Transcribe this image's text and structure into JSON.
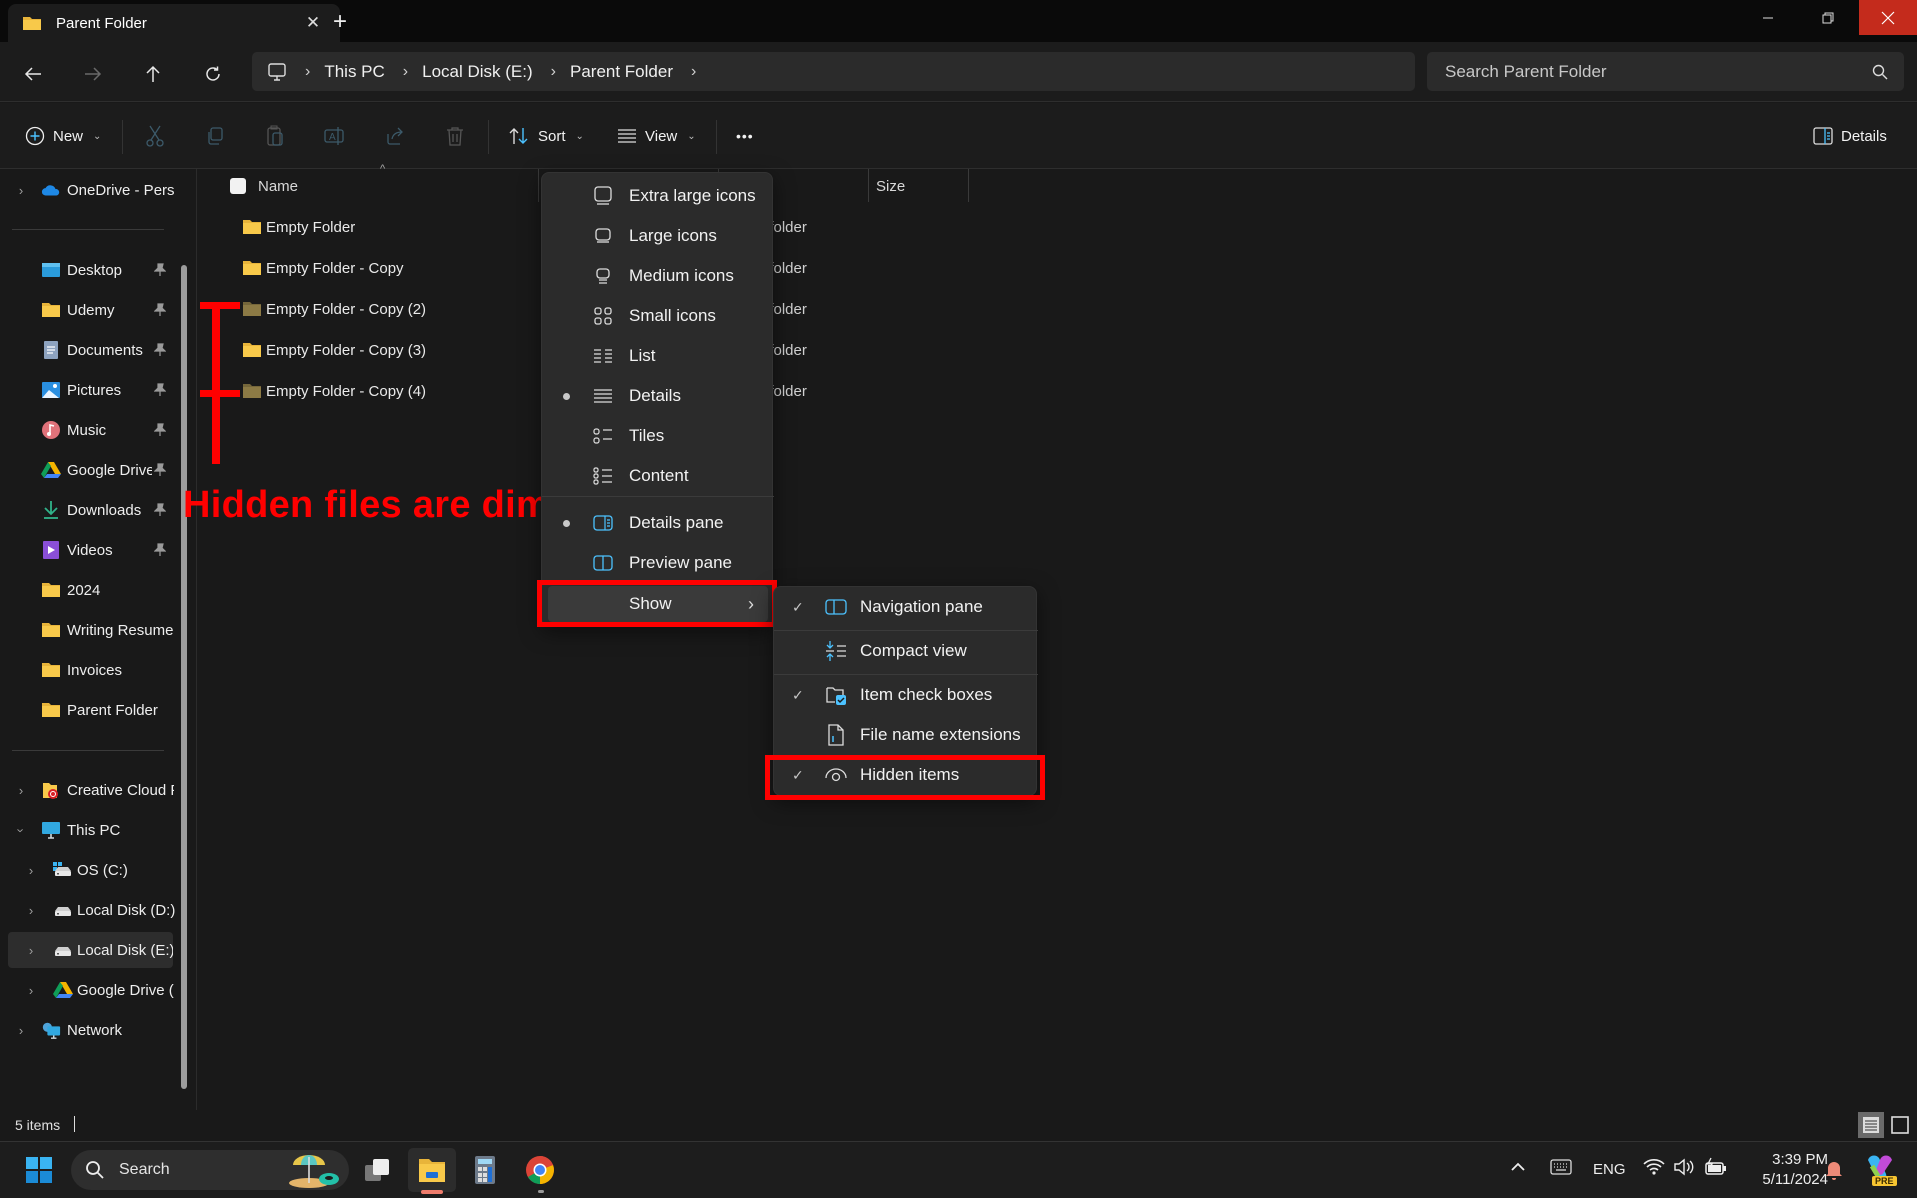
{
  "window": {
    "tab_title": "Parent Folder",
    "close_tab": "✕",
    "new_tab": "+",
    "min": "—",
    "max": "❐",
    "close": "✕"
  },
  "address": {
    "breadcrumbs": [
      "This PC",
      "Local Disk (E:)",
      "Parent Folder"
    ],
    "separator": "›"
  },
  "search": {
    "placeholder": "Search Parent Folder"
  },
  "toolbar": {
    "new_label": "New",
    "sort_label": "Sort",
    "view_label": "View",
    "more_label": "•••",
    "details_label": "Details",
    "dropdown_chevron": "⌄"
  },
  "sidebar": {
    "onedrive": "OneDrive - Perso",
    "quick_access": [
      {
        "label": "Desktop",
        "icon": "desktop-icon"
      },
      {
        "label": "Udemy",
        "icon": "folder-icon"
      },
      {
        "label": "Documents",
        "icon": "documents-icon"
      },
      {
        "label": "Pictures",
        "icon": "pictures-icon"
      },
      {
        "label": "Music",
        "icon": "music-icon"
      },
      {
        "label": "Google Drive",
        "icon": "google-drive-icon"
      },
      {
        "label": "Downloads",
        "icon": "downloads-icon"
      },
      {
        "label": "Videos",
        "icon": "videos-icon"
      },
      {
        "label": "2024",
        "icon": "folder-icon"
      },
      {
        "label": "Writing Resume",
        "icon": "folder-icon"
      },
      {
        "label": "Invoices",
        "icon": "folder-icon"
      },
      {
        "label": "Parent Folder",
        "icon": "folder-icon"
      }
    ],
    "creative_cloud": "Creative Cloud F",
    "this_pc": "This PC",
    "drives": [
      {
        "label": "OS (C:)",
        "selected": false
      },
      {
        "label": "Local Disk (D:)",
        "selected": false
      },
      {
        "label": "Local Disk (E:)",
        "selected": true
      },
      {
        "label": "Google Drive (",
        "selected": false
      }
    ],
    "network": "Network",
    "pin_glyph": "📌"
  },
  "columns": {
    "name": "Name",
    "size": "Size",
    "sort_indicator": "^"
  },
  "files": [
    {
      "name": "Empty Folder",
      "type": "File folder",
      "hidden": false
    },
    {
      "name": "Empty Folder - Copy",
      "type": "File folder",
      "hidden": false
    },
    {
      "name": "Empty Folder - Copy (2)",
      "type": "File folder",
      "hidden": true
    },
    {
      "name": "Empty Folder - Copy (3)",
      "type": "File folder",
      "hidden": false
    },
    {
      "name": "Empty Folder - Copy (4)",
      "type": "File folder",
      "hidden": true
    }
  ],
  "annotation": {
    "text": "Hidden files are dim.",
    "color": "#ff0000"
  },
  "view_menu": {
    "items": [
      {
        "label": "Extra large icons",
        "icon": "extra-large-icons-icon",
        "selected": false
      },
      {
        "label": "Large icons",
        "icon": "large-icons-icon",
        "selected": false
      },
      {
        "label": "Medium icons",
        "icon": "medium-icons-icon",
        "selected": false
      },
      {
        "label": "Small icons",
        "icon": "small-icons-icon",
        "selected": false
      },
      {
        "label": "List",
        "icon": "list-icon",
        "selected": false
      },
      {
        "label": "Details",
        "icon": "details-icon",
        "selected": true
      },
      {
        "label": "Tiles",
        "icon": "tiles-icon",
        "selected": false
      },
      {
        "label": "Content",
        "icon": "content-icon",
        "selected": false
      }
    ],
    "panes": [
      {
        "label": "Details pane",
        "selected": true
      },
      {
        "label": "Preview pane",
        "selected": false
      }
    ],
    "show_label": "Show",
    "show_chevron": "›"
  },
  "show_submenu": {
    "items": [
      {
        "label": "Navigation pane",
        "checked": true
      },
      {
        "label": "Compact view",
        "checked": false
      },
      {
        "label": "Item check boxes",
        "checked": true
      },
      {
        "label": "File name extensions",
        "checked": false
      },
      {
        "label": "Hidden items",
        "checked": true
      }
    ],
    "check_glyph": "✓"
  },
  "status": {
    "item_count": "5 items"
  },
  "taskbar": {
    "search_label": "Search",
    "language": "ENG",
    "time": "3:39 PM",
    "date": "5/11/2024",
    "copilot_badge": "PRE"
  },
  "colors": {
    "accent": "#4cc2ff",
    "folder": "#f8c94a",
    "hidden_folder": "#8c7a45",
    "close_red": "#c42b1c",
    "annotation_red": "#ff0000"
  }
}
